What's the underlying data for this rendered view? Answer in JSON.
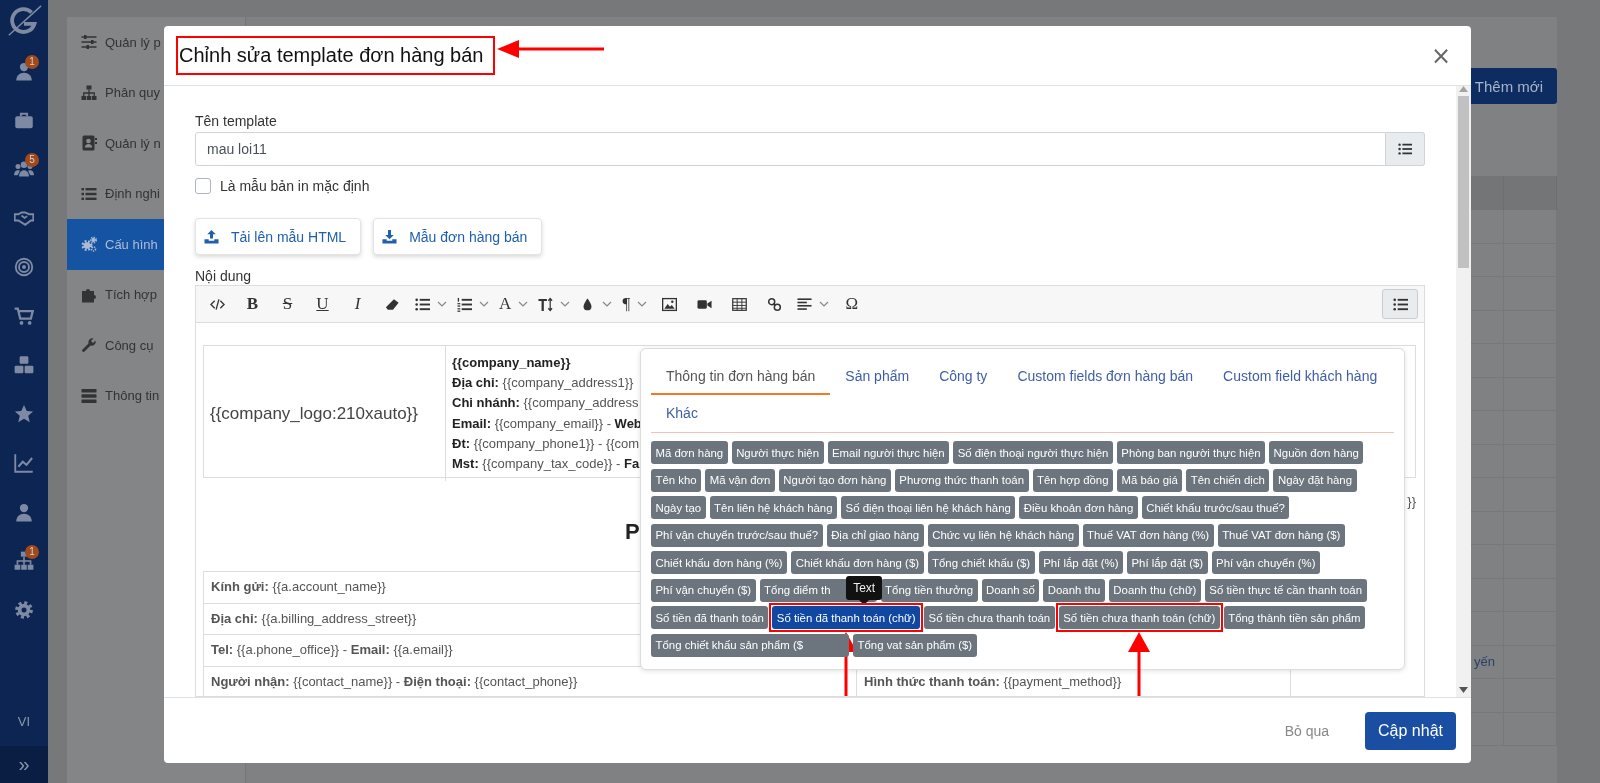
{
  "rail": {
    "items": [
      {
        "kind": "user",
        "badge": "1"
      },
      {
        "kind": "briefcase"
      },
      {
        "kind": "users",
        "badge": "5"
      },
      {
        "kind": "handshake"
      },
      {
        "kind": "target"
      },
      {
        "kind": "cart"
      },
      {
        "kind": "cubes"
      },
      {
        "kind": "star"
      },
      {
        "kind": "chart"
      },
      {
        "kind": "user"
      },
      {
        "kind": "sitemap",
        "badge": "1"
      },
      {
        "kind": "gear"
      }
    ],
    "language": "VI",
    "expand": "»"
  },
  "sidebar": {
    "items": [
      {
        "kind": "sliders",
        "label": "Quản lý p",
        "selected": false
      },
      {
        "kind": "sitemap",
        "label": "Phân quy",
        "selected": false
      },
      {
        "kind": "contact",
        "label": "Quản lý n",
        "selected": false
      },
      {
        "kind": "list",
        "label": "Định nghi",
        "selected": false
      },
      {
        "kind": "gears",
        "label": "Cấu hình",
        "selected": true
      },
      {
        "kind": "puzzle",
        "label": "Tích hợp",
        "selected": false
      },
      {
        "kind": "wrench",
        "label": "Công cụ",
        "selected": false
      },
      {
        "kind": "server",
        "label": "Thông tin",
        "selected": false
      }
    ]
  },
  "main": {
    "add_button": "Thêm mới",
    "table_cell": "yến"
  },
  "modal": {
    "title": "Chỉnh sửa template đơn hàng bán",
    "title_annotated": true,
    "close": "×",
    "name_label": "Tên template",
    "name_value": "mau loi11",
    "default_checkbox": {
      "label": "Là mẫu bản in mặc định",
      "checked": false
    },
    "upload_button": "Tải lên mẫu HTML",
    "sample_button": "Mẫu đơn hàng bán",
    "content_label": "Nội dung",
    "toolbar": [
      {
        "kind": "code",
        "dropdown": false
      },
      {
        "kind": "bold",
        "text": "B",
        "dropdown": false
      },
      {
        "kind": "strike",
        "text": "S",
        "dropdown": false
      },
      {
        "kind": "underline",
        "text": "U",
        "dropdown": false
      },
      {
        "kind": "italic",
        "text": "I",
        "dropdown": false
      },
      {
        "kind": "eraser",
        "dropdown": false
      },
      {
        "kind": "bullets",
        "dropdown": true
      },
      {
        "kind": "numbers",
        "dropdown": true
      },
      {
        "kind": "font",
        "text": "A",
        "dropdown": true
      },
      {
        "kind": "size",
        "dropdown": true
      },
      {
        "kind": "color",
        "dropdown": true
      },
      {
        "kind": "paragraph",
        "text": "¶",
        "dropdown": true
      },
      {
        "kind": "image",
        "dropdown": false
      },
      {
        "kind": "video",
        "dropdown": false
      },
      {
        "kind": "table",
        "dropdown": false
      },
      {
        "kind": "link",
        "dropdown": false
      },
      {
        "kind": "align",
        "dropdown": true
      },
      {
        "kind": "symbol",
        "text": "Ω",
        "dropdown": false
      }
    ],
    "document": {
      "logo": "{{company_logo:210xauto}}",
      "company_name": "{{company_name}}",
      "company_lines": [
        "**Địa chỉ:** {{company_address1}}",
        "**Chi nhánh:** {{company_address",
        "**Email:** {{company_email}} - **Web**",
        "**Đt:** {{company_phone1}} - {{com",
        "**Mst:** {{company_tax_code}} - **Fa**"
      ],
      "right_line": "}}",
      "heading": "P",
      "rows": [
        {
          "cells": [
            "**Kính gửi:** {{a.account_name}}"
          ]
        },
        {
          "cells": [
            "**Địa chỉ:** {{a.billing_address_street}}"
          ]
        },
        {
          "cells": [
            "**Tel:** {{a.phone_office}} - **Email:** {{a.email}}"
          ]
        },
        {
          "cells": [
            "**Người nhận:** {{contact_name}} - **Điện thoại:** {{contact_phone}}",
            "**Hình thức thanh toán:** {{payment_method}}"
          ]
        }
      ]
    },
    "field_picker": {
      "tabs": [
        {
          "label": "Thông tin đơn hàng bán",
          "selected": true
        },
        {
          "label": "Sản phẩm",
          "selected": false
        },
        {
          "label": "Công ty",
          "selected": false
        },
        {
          "label": "Custom fields đơn hàng bán",
          "selected": false
        },
        {
          "label": "Custom field khách hàng",
          "selected": false
        },
        {
          "label": "Khác",
          "selected": false
        }
      ],
      "tooltip": "Text",
      "tags": [
        {
          "label": "Mã đơn hàng",
          "selected": false,
          "highlighted": false,
          "covered": false
        },
        {
          "label": "Người thực hiện",
          "selected": false,
          "highlighted": false,
          "covered": false
        },
        {
          "label": "Email người thực hiện",
          "selected": false,
          "highlighted": false,
          "covered": false
        },
        {
          "label": "Số điện thoại người thực hiện",
          "selected": false,
          "highlighted": false,
          "covered": false
        },
        {
          "label": "Phòng ban người thực hiện",
          "selected": false,
          "highlighted": false,
          "covered": false
        },
        {
          "label": "Nguồn đơn hàng",
          "selected": false,
          "highlighted": false,
          "covered": false
        },
        {
          "label": "Tên kho",
          "selected": false,
          "highlighted": false,
          "covered": false
        },
        {
          "label": "Mã vận đơn",
          "selected": false,
          "highlighted": false,
          "covered": false
        },
        {
          "label": "Người tạo đơn hàng",
          "selected": false,
          "highlighted": false,
          "covered": false
        },
        {
          "label": "Phương thức thanh toán",
          "selected": false,
          "highlighted": false,
          "covered": false
        },
        {
          "label": "Tên hợp đồng",
          "selected": false,
          "highlighted": false,
          "covered": false
        },
        {
          "label": "Mã báo giá",
          "selected": false,
          "highlighted": false,
          "covered": false
        },
        {
          "label": "Tên chiến dịch",
          "selected": false,
          "highlighted": false,
          "covered": false
        },
        {
          "label": "Ngày đặt hàng",
          "selected": false,
          "highlighted": false,
          "covered": false
        },
        {
          "label": "Ngày tạo",
          "selected": false,
          "highlighted": false,
          "covered": false
        },
        {
          "label": "Tên liên hệ khách hàng",
          "selected": false,
          "highlighted": false,
          "covered": false
        },
        {
          "label": "Số điện thoại liên hệ khách hàng",
          "selected": false,
          "highlighted": false,
          "covered": false
        },
        {
          "label": "Điều khoản đơn hàng",
          "selected": false,
          "highlighted": false,
          "covered": false
        },
        {
          "label": "Chiết khấu trước/sau thuế?",
          "selected": false,
          "highlighted": false,
          "covered": false
        },
        {
          "label": "Phí vận chuyển trước/sau thuế?",
          "selected": false,
          "highlighted": false,
          "covered": false
        },
        {
          "label": "Địa chỉ giao hàng",
          "selected": false,
          "highlighted": false,
          "covered": false
        },
        {
          "label": "Chức vụ liên hệ khách hàng",
          "selected": false,
          "highlighted": false,
          "covered": false
        },
        {
          "label": "Thuế VAT đơn hàng (%)",
          "selected": false,
          "highlighted": false,
          "covered": false
        },
        {
          "label": "Thuế VAT đơn hàng ($)",
          "selected": false,
          "highlighted": false,
          "covered": false
        },
        {
          "label": "Chiết khấu đơn hàng (%)",
          "selected": false,
          "highlighted": false,
          "covered": false
        },
        {
          "label": "Chiết khấu đơn hàng ($)",
          "selected": false,
          "highlighted": false,
          "covered": false
        },
        {
          "label": "Tổng chiết khấu ($)",
          "selected": false,
          "highlighted": false,
          "covered": false
        },
        {
          "label": "Phí lắp đặt (%)",
          "selected": false,
          "highlighted": false,
          "covered": false
        },
        {
          "label": "Phí lắp đặt ($)",
          "selected": false,
          "highlighted": false,
          "covered": false
        },
        {
          "label": "Phí vận chuyển (%)",
          "selected": false,
          "highlighted": false,
          "covered": false
        },
        {
          "label": "Phí vận chuyển ($)",
          "selected": false,
          "highlighted": false,
          "covered": false
        },
        {
          "label": "Tổng điểm th",
          "selected": false,
          "highlighted": false,
          "covered": true
        },
        {
          "label": "Tổng tiền thưởng",
          "selected": false,
          "highlighted": false,
          "covered": false
        },
        {
          "label": "Doanh số",
          "selected": false,
          "highlighted": false,
          "covered": false
        },
        {
          "label": "Doanh thu",
          "selected": false,
          "highlighted": false,
          "covered": false
        },
        {
          "label": "Doanh thu (chữ)",
          "selected": false,
          "highlighted": false,
          "covered": false
        },
        {
          "label": "Số tiền thực tế cần thanh toán",
          "selected": false,
          "highlighted": false,
          "covered": false
        },
        {
          "label": "Số tiền đã thanh toán",
          "selected": false,
          "highlighted": false,
          "covered": false
        },
        {
          "label": "Số tiền đã thanh toán (chữ)",
          "selected": true,
          "highlighted": true,
          "covered": false
        },
        {
          "label": "Số tiền chưa thanh toán",
          "selected": false,
          "highlighted": false,
          "covered": false
        },
        {
          "label": "Số tiền chưa thanh toán (chữ)",
          "selected": false,
          "highlighted": true,
          "covered": false
        },
        {
          "label": "Tổng thành tiền sản phẩm",
          "selected": false,
          "highlighted": false,
          "covered": false
        },
        {
          "label": "Tổng chiết khấu sản phẩm ($",
          "selected": false,
          "highlighted": false,
          "covered": true
        },
        {
          "label": "Tổng vat sản phẩm ($)",
          "selected": false,
          "highlighted": false,
          "covered": false
        }
      ]
    },
    "cancel_button": "Bỏ qua",
    "save_button": "Cập nhật"
  }
}
